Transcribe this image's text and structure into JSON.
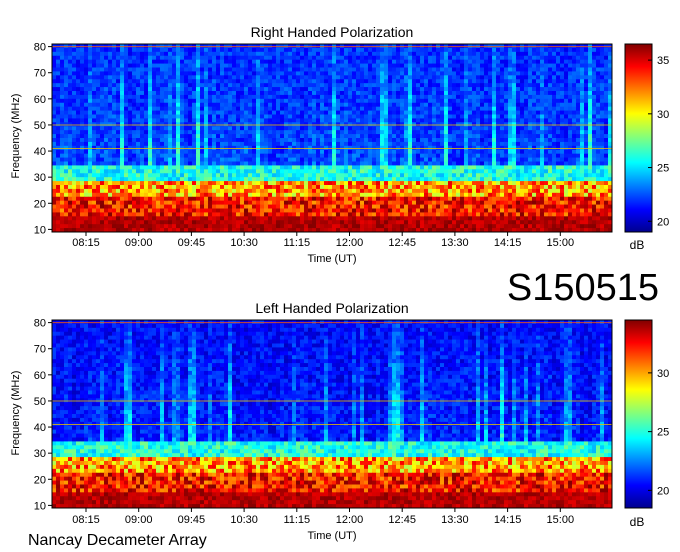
{
  "figure": {
    "station_id": "S150515",
    "footer": "Nancay Decameter Array"
  },
  "chart_data": [
    {
      "type": "heatmap",
      "title": "Right Handed Polarization",
      "xlabel": "Time (UT)",
      "ylabel": "Frequency (MHz)",
      "x_ticks": [
        "08:15",
        "09:00",
        "09:45",
        "10:30",
        "11:15",
        "12:00",
        "12:45",
        "13:30",
        "14:15",
        "15:00"
      ],
      "y_ticks": [
        10,
        20,
        30,
        40,
        50,
        60,
        70,
        80
      ],
      "ylim": [
        9,
        81
      ],
      "colorbar": {
        "label": "dB",
        "ticks": [
          20,
          25,
          30,
          35
        ],
        "range": [
          19,
          36.5
        ]
      },
      "colors": {
        "low": "#00008f",
        "high": "#800000"
      }
    },
    {
      "type": "heatmap",
      "title": "Left Handed Polarization",
      "xlabel": "Time (UT)",
      "ylabel": "Frequency (MHz)",
      "x_ticks": [
        "08:15",
        "09:00",
        "09:45",
        "10:30",
        "11:15",
        "12:00",
        "12:45",
        "13:30",
        "14:15",
        "15:00"
      ],
      "y_ticks": [
        10,
        20,
        30,
        40,
        50,
        60,
        70,
        80
      ],
      "ylim": [
        9,
        81
      ],
      "colorbar": {
        "label": "dB",
        "ticks": [
          20,
          25,
          30
        ],
        "range": [
          18.5,
          34.5
        ]
      },
      "colors": {
        "low": "#00008f",
        "high": "#800000"
      }
    }
  ]
}
